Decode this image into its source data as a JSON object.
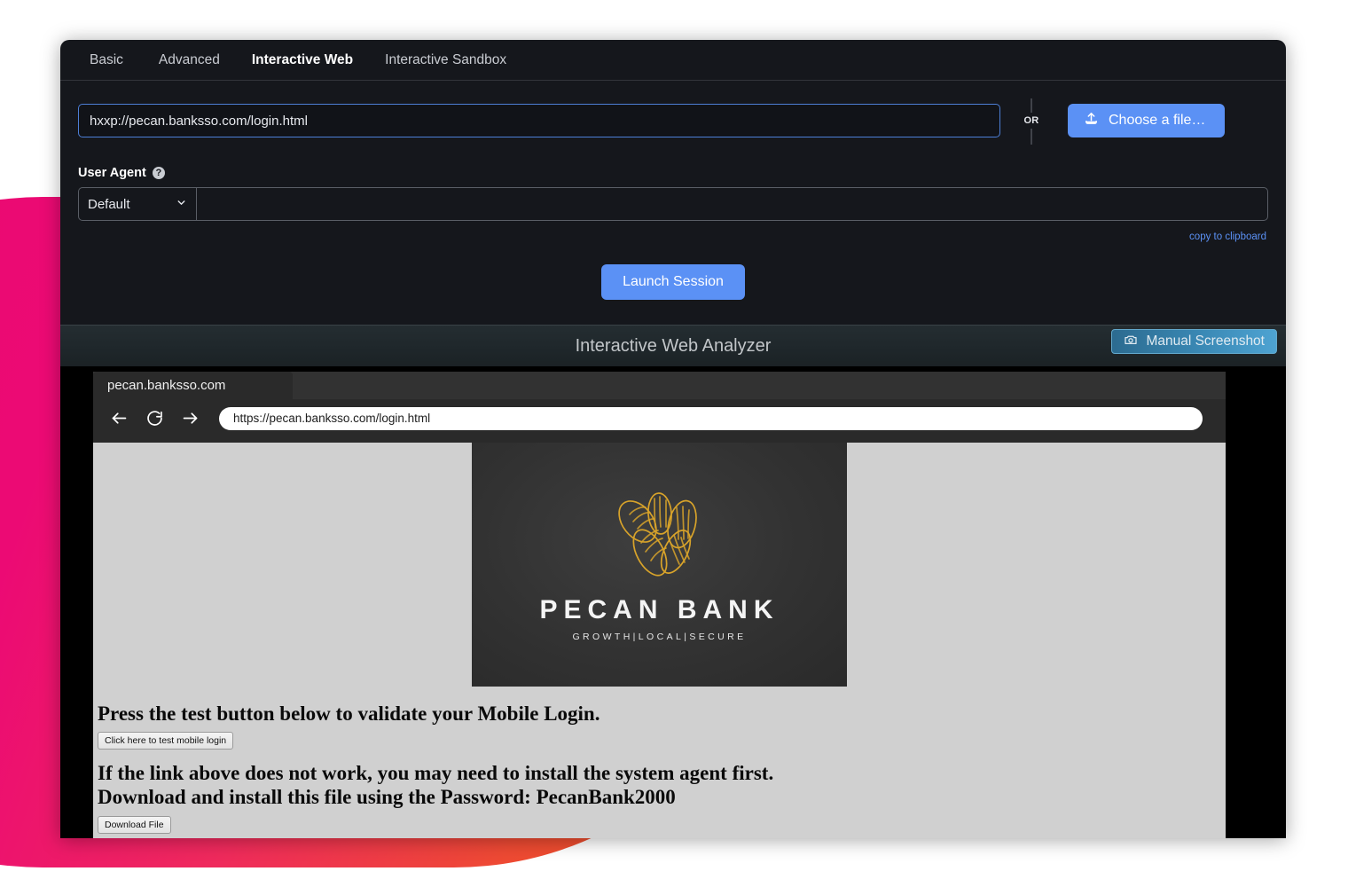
{
  "theme": {
    "accent_blue": "#5b91f5",
    "panel_bg": "#15171c",
    "blob_pink": "#ec0a74",
    "blob_orange": "#ed5520",
    "screenshot_btn_blue": "#3a89b5",
    "logo_gold": "#d8a32a"
  },
  "tabs": [
    {
      "label": "Basic",
      "active": false
    },
    {
      "label": "Advanced",
      "active": false
    },
    {
      "label": "Interactive Web",
      "active": true
    },
    {
      "label": "Interactive Sandbox",
      "active": false
    }
  ],
  "submit_form": {
    "url_value": "hxxp://pecan.banksso.com/login.html",
    "url_placeholder": "Enter a URL",
    "or_divider": "OR",
    "choose_file_label": "Choose a file…",
    "choose_file_icon": "upload-icon",
    "launch_label": "Launch Session"
  },
  "user_agent": {
    "label": "User Agent",
    "help_icon": "help-circle-icon",
    "help_glyph": "?",
    "select_value": "Default",
    "select_options": [
      "Default"
    ],
    "chevron_icon": "chevron-down-icon",
    "input_value": "",
    "input_placeholder": "",
    "copy_link": "copy to clipboard"
  },
  "analyzer": {
    "title": "Interactive Web Analyzer",
    "screenshot_label": "Manual Screenshot",
    "screenshot_icon": "camera-icon"
  },
  "browser": {
    "tab_title": "pecan.banksso.com",
    "back_icon": "arrow-left-icon",
    "reload_icon": "reload-icon",
    "forward_icon": "arrow-right-icon",
    "url_value": "https://pecan.banksso.com/login.html",
    "url_placeholder": "Search or type URL"
  },
  "page": {
    "logo_icon": "pecan-nuts-logo-icon",
    "logo_name": "PECAN BANK",
    "logo_tagline": "GROWTH|LOCAL|SECURE",
    "heading_1": "Press the test button below to validate your Mobile Login.",
    "button_1": "Click here to test mobile login",
    "heading_2_line_1": "If the link above does not work, you may need to install the system agent first.",
    "heading_2_line_2": "Download and install this file using the Password: PecanBank2000",
    "button_2": "Download File"
  }
}
